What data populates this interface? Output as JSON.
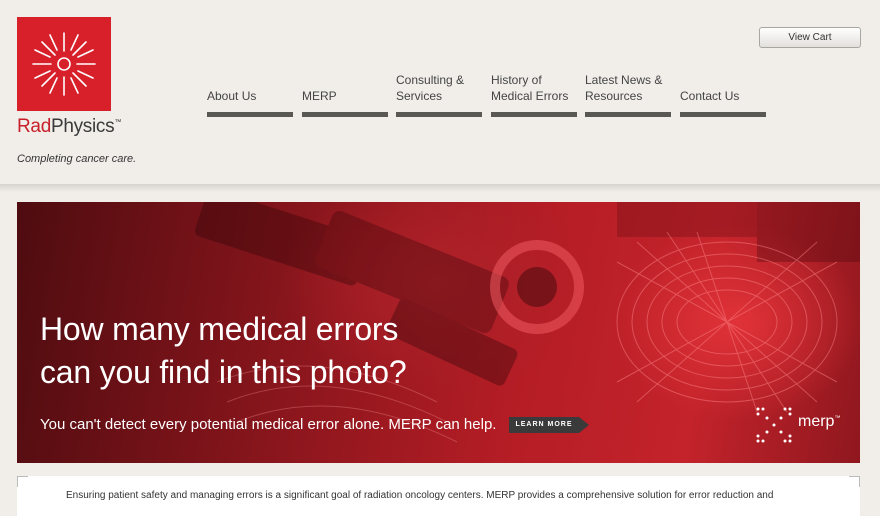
{
  "brand": {
    "name_part1": "Rad",
    "name_part2": "Physics",
    "trademark": "™",
    "tagline": "Completing cancer care."
  },
  "header": {
    "view_cart": "View Cart"
  },
  "nav": {
    "items": [
      {
        "line1": "About Us",
        "line2": ""
      },
      {
        "line1": "MERP",
        "line2": ""
      },
      {
        "line1": "Consulting &",
        "line2": "Services"
      },
      {
        "line1": "History of",
        "line2": "Medical Errors"
      },
      {
        "line1": "Latest News &",
        "line2": "Resources"
      },
      {
        "line1": "Contact Us",
        "line2": ""
      }
    ]
  },
  "hero": {
    "headline_line1": "How many medical errors",
    "headline_line2": "can you find in this photo?",
    "subtext": "You can't detect every potential medical error alone. MERP can help.",
    "cta": "LEARN MORE",
    "product_logo": "merp",
    "product_tm": "™"
  },
  "content": {
    "intro": "Ensuring patient safety and managing errors is a significant goal of radiation oncology centers. MERP provides a comprehensive solution for error reduction and"
  },
  "colors": {
    "brand_red": "#d8202a",
    "nav_bar": "#5a5852",
    "page_bg": "#f1eeea"
  }
}
